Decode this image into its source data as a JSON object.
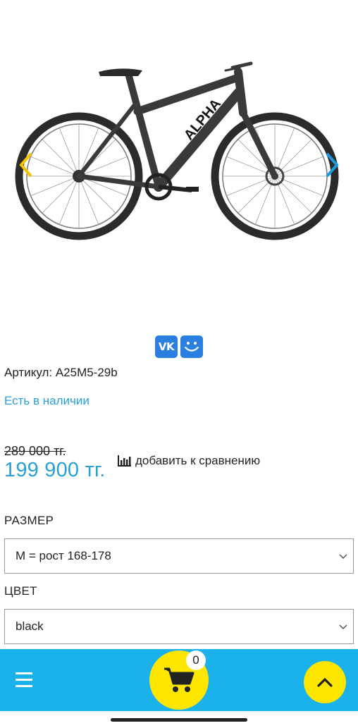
{
  "gallery": {
    "image_alt": "Bicycle ALPHA",
    "frame_text": "ALPHA",
    "prev_icon": "chevron-left-icon",
    "next_icon": "chevron-right-icon",
    "prev_color": "#f2c500",
    "next_color": "#1a9be0"
  },
  "share": {
    "vk_label": "VK",
    "mm_icon": "smile-icon",
    "color": "#2a7fe0"
  },
  "product": {
    "sku": "Артикул: A25M5-29b",
    "stock": "Есть в наличии",
    "old_price": "289 000 тг.",
    "new_price": "199 900 тг.",
    "compare_label": "добавить к сравнению",
    "compare_icon": "bar-chart-icon"
  },
  "options": {
    "size_label": "РАЗМЕР",
    "size_value": "M = рост 168-178",
    "color_label": "ЦВЕТ",
    "color_value": "black"
  },
  "bottombar": {
    "bg_color": "#1bb2ec",
    "button_color": "#ffe600",
    "menu_icon": "hamburger-icon",
    "cart_icon": "cart-icon",
    "cart_count": "0",
    "up_icon": "chevron-up-icon"
  }
}
